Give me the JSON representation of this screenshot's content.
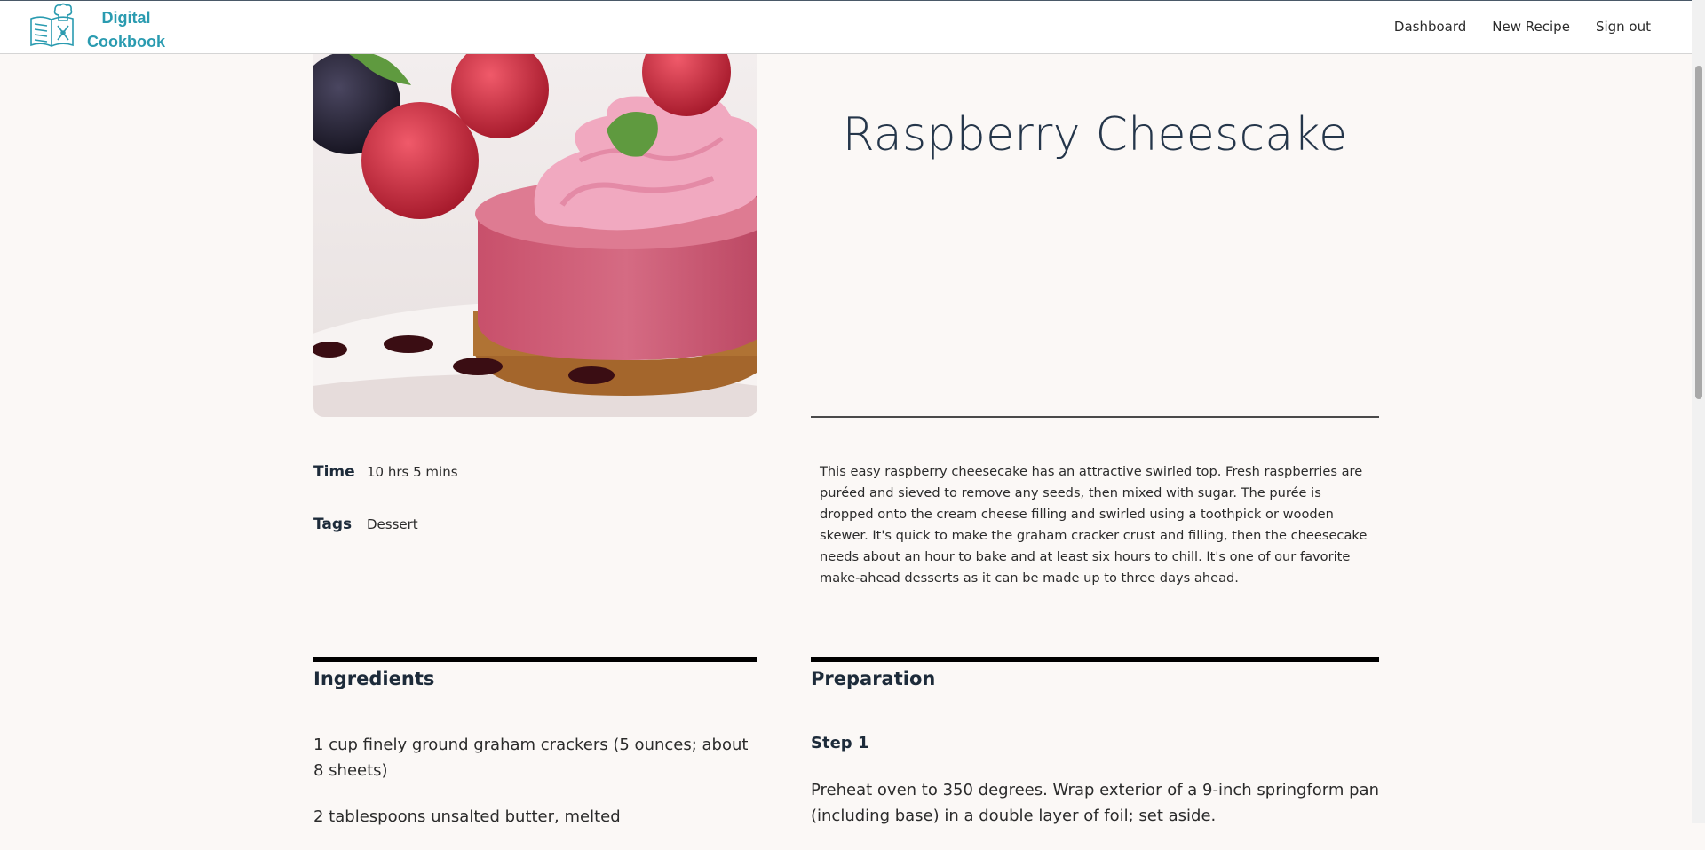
{
  "header": {
    "brand_line1": "Digital",
    "brand_line2": "Cookbook",
    "nav": [
      "Dashboard",
      "New Recipe",
      "Sign out"
    ]
  },
  "recipe": {
    "title": "Raspberry Cheescake",
    "time_label": "Time",
    "time_value": "10 hrs 5 mins",
    "tags_label": "Tags",
    "tags_value": "Dessert",
    "description": "This easy raspberry cheesecake has an attractive swirled top. Fresh raspberries are puréed and sieved to remove any seeds, then mixed with sugar. The purée is dropped onto the cream cheese filling and swirled using a toothpick or wooden skewer. It's quick to make the graham cracker crust and filling, then the cheesecake needs about an hour to bake and at least six hours to chill. It's one of our favorite make-ahead desserts as it can be made up to three days ahead.",
    "ingredients_heading": "Ingredients",
    "ingredients": [
      "1 cup finely ground graham crackers (5 ounces; about 8 sheets)",
      "2 tablespoons unsalted butter, melted"
    ],
    "preparation_heading": "Preparation",
    "steps": [
      {
        "title": "Step 1",
        "text": "Preheat oven to 350 degrees. Wrap exterior of a 9-inch springform pan (including base) in a double layer of foil; set aside."
      }
    ]
  },
  "colors": {
    "brand": "#2a9bb0",
    "background": "#fbf8f6",
    "heading": "#1d2b3a"
  },
  "icons": {
    "logo": "cookbook-chef-hat-icon",
    "hero": "raspberry-cheesecake-photo"
  }
}
